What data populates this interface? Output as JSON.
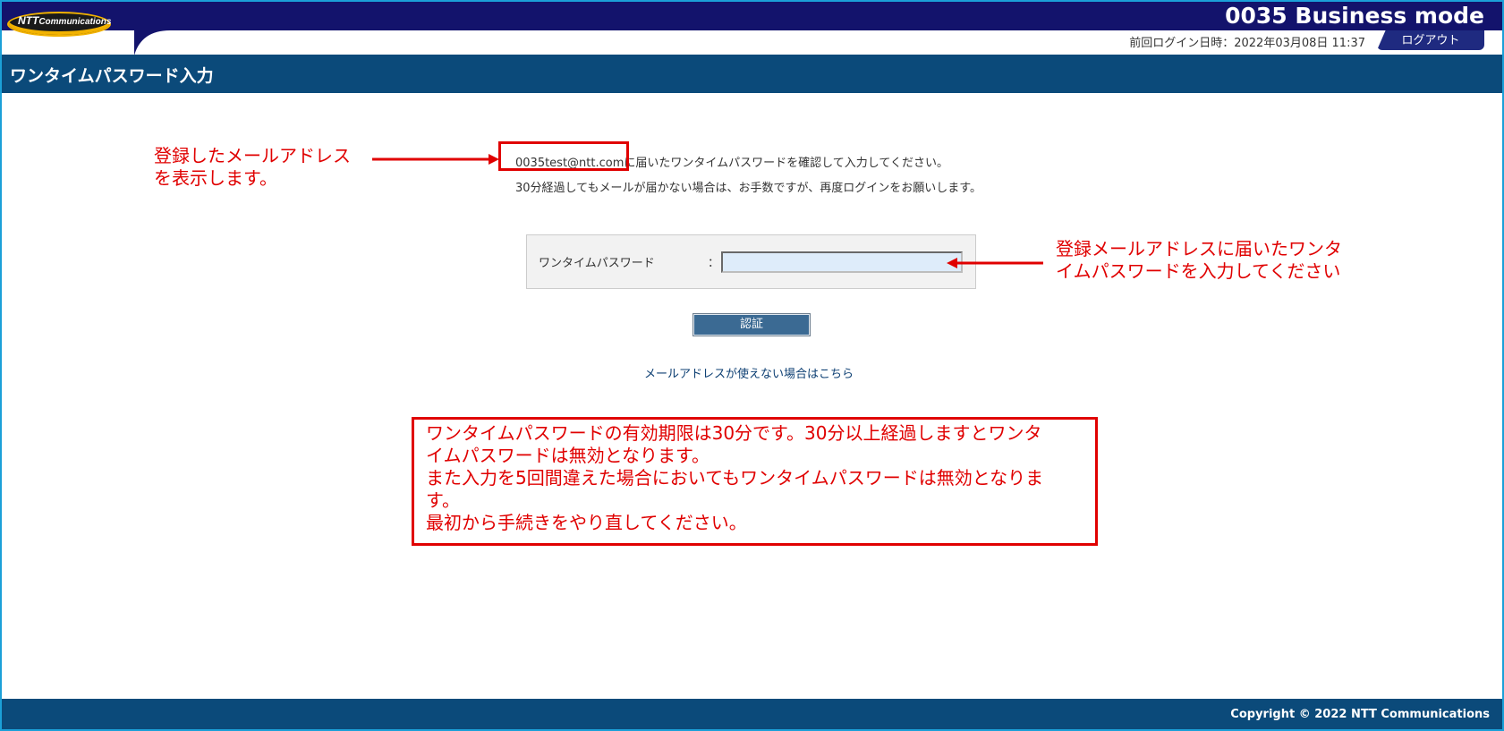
{
  "header": {
    "logo_text_ntt": "NTT",
    "logo_text_rest": "Communications",
    "brand": "0035 Business mode",
    "last_login_label": "前回ログイン日時：2022年03月08日 11:37",
    "logout_label": "ログアウト"
  },
  "page": {
    "title": "ワンタイムパスワード入力"
  },
  "content": {
    "email": "0035test@ntt.com",
    "message_line1_suffix": "に届いたワンタイムパスワードを確認して入力してください。",
    "message_line2": "30分経過してもメールが届かない場合は、お手数ですが、再度ログインをお願いします。",
    "form_label": "ワンタイムパスワード",
    "form_colon": "：",
    "otp_value": "",
    "auth_button": "認証",
    "help_link": "メールアドレスが使えない場合はこちら"
  },
  "annotations": {
    "left_line1": "登録したメールアドレス",
    "left_line2": "を表示します。",
    "right_line1": "登録メールアドレスに届いたワンタ",
    "right_line2": "イムパスワードを入力してください",
    "note_line1": "ワンタイムパスワードの有効期限は30分です。30分以上経過しますとワンタ",
    "note_line2": "イムパスワードは無効となります。",
    "note_line3": "また入力を5回間違えた場合においてもワンタイムパスワードは無効となりま",
    "note_line4": "す。",
    "note_line5": "最初から手続きをやり直してください。"
  },
  "footer": {
    "copyright": "Copyright © 2022 NTT Communications"
  },
  "colors": {
    "header_navy": "#13136c",
    "title_bar": "#0b4a7a",
    "annotation_red": "#e00000",
    "input_bg": "#deecfa",
    "button_bg": "#3b6a93"
  }
}
